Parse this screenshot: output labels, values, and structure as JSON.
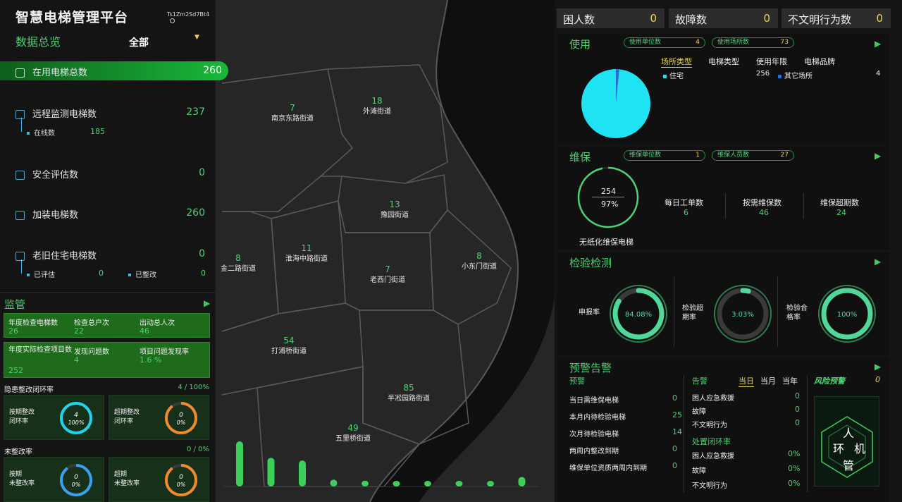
{
  "header": {
    "title": "智慧电梯管理平台",
    "user": "Ts1Zm2Sd7Bt4"
  },
  "overview": {
    "title": "数据总览",
    "filter": "全部"
  },
  "left_stats": {
    "in_use": {
      "label": "在用电梯总数",
      "value": "260"
    },
    "remote": {
      "label": "远程监测电梯数",
      "value": "237",
      "online_label": "在线数",
      "online_value": "185"
    },
    "safety": {
      "label": "安全评估数",
      "value": "0"
    },
    "installed": {
      "label": "加装电梯数",
      "value": "260"
    },
    "old": {
      "label": "老旧住宅电梯数",
      "value": "0",
      "assessed_label": "已评估",
      "assessed_value": "0",
      "fixed_label": "已整改",
      "fixed_value": "0"
    }
  },
  "supervision": {
    "title": "监管",
    "boxes": [
      {
        "label": "年度检查电梯数",
        "value": "26"
      },
      {
        "label": "检查总户次",
        "value": "22"
      },
      {
        "label": "出动总人次",
        "value": "46"
      },
      {
        "label": "年度实际检查项目数",
        "value": "252"
      },
      {
        "label": "发现问题数",
        "value": "4"
      },
      {
        "label": "项目问题发现率",
        "value": "1.6 %"
      }
    ],
    "hazard": {
      "label": "隐患整改闭环率",
      "value": "4 / 100%"
    },
    "hazard_cards": [
      {
        "label_1": "按期整改",
        "label_2": "闭环率",
        "n": "4",
        "pct": "100%",
        "fill": 1.0
      },
      {
        "label_1": "超期整改",
        "label_2": "闭环率",
        "n": "0",
        "pct": "0%",
        "fill": 0
      }
    ],
    "unfixed": {
      "label": "未整改率",
      "value": "0 / 0%"
    },
    "unfixed_cards": [
      {
        "label_1": "按期",
        "label_2": "未整改率",
        "n": "0",
        "pct": "0%",
        "fill": 0
      },
      {
        "label_1": "超期",
        "label_2": "未整改率",
        "n": "0",
        "pct": "0%",
        "fill": 0
      }
    ]
  },
  "map": {
    "districts": [
      {
        "name": "南京东路街道",
        "count": "7"
      },
      {
        "name": "外滩街道",
        "count": "18"
      },
      {
        "name": "豫园街道",
        "count": "13"
      },
      {
        "name": "金二路街道",
        "count": "8"
      },
      {
        "name": "淮海中路街道",
        "count": "11"
      },
      {
        "name": "小东门街道",
        "count": "8"
      },
      {
        "name": "老西门街道",
        "count": "7"
      },
      {
        "name": "打浦桥街道",
        "count": "54"
      },
      {
        "name": "半凇园路街道",
        "count": "85"
      },
      {
        "name": "五里桥街道",
        "count": "49"
      }
    ],
    "bars": [
      85,
      54,
      49,
      13,
      11,
      8,
      8,
      7,
      7,
      18
    ]
  },
  "top_stats": [
    {
      "label": "困人数",
      "value": "0"
    },
    {
      "label": "故障数",
      "value": "0"
    },
    {
      "label": "不文明行为数",
      "value": "0"
    }
  ],
  "usage": {
    "title": "使用",
    "pills": [
      {
        "label": "使用单位数",
        "value": "4"
      },
      {
        "label": "使用场所数",
        "value": "73"
      }
    ],
    "tabs": [
      "场所类型",
      "电梯类型",
      "使用年限",
      "电梯品牌"
    ],
    "legend": [
      {
        "label": "住宅",
        "value": "256"
      },
      {
        "label": "其它场所",
        "value": "4"
      }
    ],
    "color_main": "#1fe3f2",
    "color_other": "#2a6bd6"
  },
  "maintenance": {
    "title": "维保",
    "pills": [
      {
        "label": "维保单位数",
        "value": "1"
      },
      {
        "label": "维保人员数",
        "value": "27"
      }
    ],
    "ring_top": "254",
    "ring_bottom": "97%",
    "ring_fill": 0.97,
    "ring_caption": "无纸化维保电梯",
    "items": [
      {
        "label": "每日工单数",
        "value": "6"
      },
      {
        "label": "按需维保数",
        "value": "46"
      },
      {
        "label": "维保超期数",
        "value": "24"
      }
    ]
  },
  "inspection": {
    "title": "检验检测",
    "items": [
      {
        "label_1": "申报率",
        "label_2": "",
        "value": "84.08%",
        "fill": 0.8408
      },
      {
        "label_1": "检验超",
        "label_2": "期率",
        "value": "3.03%",
        "fill": 0.0303
      },
      {
        "label_1": "检验合",
        "label_2": "格率",
        "value": "100%",
        "fill": 1.0
      }
    ]
  },
  "alerts": {
    "title": "预警告警",
    "warning_title": "预警",
    "warnings": [
      {
        "label": "当日需维保电梯",
        "value": "0"
      },
      {
        "label": "本月内待检验电梯",
        "value": "25"
      },
      {
        "label": "次月待检验电梯",
        "value": "14"
      },
      {
        "label": "两周内整改到期",
        "value": "0"
      },
      {
        "label": "维保单位资质两周内到期",
        "value": "0"
      }
    ],
    "alarm_title": "告警",
    "tabs": [
      "当日",
      "当月",
      "当年"
    ],
    "alarms": [
      {
        "label": "困人应急救援",
        "value": "0"
      },
      {
        "label": "故障",
        "value": "0"
      },
      {
        "label": "不文明行为",
        "value": "0"
      }
    ],
    "closed_title": "处置闭环率",
    "closed": [
      {
        "label": "困人应急救援",
        "value": "0%"
      },
      {
        "label": "故障",
        "value": "0%"
      },
      {
        "label": "不文明行为",
        "value": "0%"
      }
    ],
    "risk_title": "风险预警",
    "risk_value": "0",
    "badge_chars": [
      "人",
      "环",
      "机",
      "管"
    ]
  }
}
